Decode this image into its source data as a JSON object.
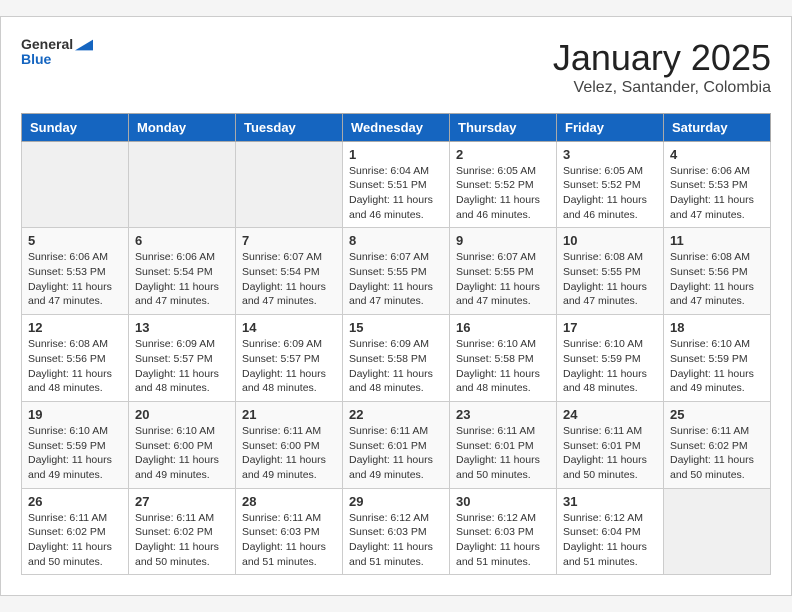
{
  "header": {
    "logo_general": "General",
    "logo_blue": "Blue",
    "month": "January 2025",
    "location": "Velez, Santander, Colombia"
  },
  "weekdays": [
    "Sunday",
    "Monday",
    "Tuesday",
    "Wednesday",
    "Thursday",
    "Friday",
    "Saturday"
  ],
  "weeks": [
    [
      {
        "day": "",
        "info": ""
      },
      {
        "day": "",
        "info": ""
      },
      {
        "day": "",
        "info": ""
      },
      {
        "day": "1",
        "info": "Sunrise: 6:04 AM\nSunset: 5:51 PM\nDaylight: 11 hours and 46 minutes."
      },
      {
        "day": "2",
        "info": "Sunrise: 6:05 AM\nSunset: 5:52 PM\nDaylight: 11 hours and 46 minutes."
      },
      {
        "day": "3",
        "info": "Sunrise: 6:05 AM\nSunset: 5:52 PM\nDaylight: 11 hours and 46 minutes."
      },
      {
        "day": "4",
        "info": "Sunrise: 6:06 AM\nSunset: 5:53 PM\nDaylight: 11 hours and 47 minutes."
      }
    ],
    [
      {
        "day": "5",
        "info": "Sunrise: 6:06 AM\nSunset: 5:53 PM\nDaylight: 11 hours and 47 minutes."
      },
      {
        "day": "6",
        "info": "Sunrise: 6:06 AM\nSunset: 5:54 PM\nDaylight: 11 hours and 47 minutes."
      },
      {
        "day": "7",
        "info": "Sunrise: 6:07 AM\nSunset: 5:54 PM\nDaylight: 11 hours and 47 minutes."
      },
      {
        "day": "8",
        "info": "Sunrise: 6:07 AM\nSunset: 5:55 PM\nDaylight: 11 hours and 47 minutes."
      },
      {
        "day": "9",
        "info": "Sunrise: 6:07 AM\nSunset: 5:55 PM\nDaylight: 11 hours and 47 minutes."
      },
      {
        "day": "10",
        "info": "Sunrise: 6:08 AM\nSunset: 5:55 PM\nDaylight: 11 hours and 47 minutes."
      },
      {
        "day": "11",
        "info": "Sunrise: 6:08 AM\nSunset: 5:56 PM\nDaylight: 11 hours and 47 minutes."
      }
    ],
    [
      {
        "day": "12",
        "info": "Sunrise: 6:08 AM\nSunset: 5:56 PM\nDaylight: 11 hours and 48 minutes."
      },
      {
        "day": "13",
        "info": "Sunrise: 6:09 AM\nSunset: 5:57 PM\nDaylight: 11 hours and 48 minutes."
      },
      {
        "day": "14",
        "info": "Sunrise: 6:09 AM\nSunset: 5:57 PM\nDaylight: 11 hours and 48 minutes."
      },
      {
        "day": "15",
        "info": "Sunrise: 6:09 AM\nSunset: 5:58 PM\nDaylight: 11 hours and 48 minutes."
      },
      {
        "day": "16",
        "info": "Sunrise: 6:10 AM\nSunset: 5:58 PM\nDaylight: 11 hours and 48 minutes."
      },
      {
        "day": "17",
        "info": "Sunrise: 6:10 AM\nSunset: 5:59 PM\nDaylight: 11 hours and 48 minutes."
      },
      {
        "day": "18",
        "info": "Sunrise: 6:10 AM\nSunset: 5:59 PM\nDaylight: 11 hours and 49 minutes."
      }
    ],
    [
      {
        "day": "19",
        "info": "Sunrise: 6:10 AM\nSunset: 5:59 PM\nDaylight: 11 hours and 49 minutes."
      },
      {
        "day": "20",
        "info": "Sunrise: 6:10 AM\nSunset: 6:00 PM\nDaylight: 11 hours and 49 minutes."
      },
      {
        "day": "21",
        "info": "Sunrise: 6:11 AM\nSunset: 6:00 PM\nDaylight: 11 hours and 49 minutes."
      },
      {
        "day": "22",
        "info": "Sunrise: 6:11 AM\nSunset: 6:01 PM\nDaylight: 11 hours and 49 minutes."
      },
      {
        "day": "23",
        "info": "Sunrise: 6:11 AM\nSunset: 6:01 PM\nDaylight: 11 hours and 50 minutes."
      },
      {
        "day": "24",
        "info": "Sunrise: 6:11 AM\nSunset: 6:01 PM\nDaylight: 11 hours and 50 minutes."
      },
      {
        "day": "25",
        "info": "Sunrise: 6:11 AM\nSunset: 6:02 PM\nDaylight: 11 hours and 50 minutes."
      }
    ],
    [
      {
        "day": "26",
        "info": "Sunrise: 6:11 AM\nSunset: 6:02 PM\nDaylight: 11 hours and 50 minutes."
      },
      {
        "day": "27",
        "info": "Sunrise: 6:11 AM\nSunset: 6:02 PM\nDaylight: 11 hours and 50 minutes."
      },
      {
        "day": "28",
        "info": "Sunrise: 6:11 AM\nSunset: 6:03 PM\nDaylight: 11 hours and 51 minutes."
      },
      {
        "day": "29",
        "info": "Sunrise: 6:12 AM\nSunset: 6:03 PM\nDaylight: 11 hours and 51 minutes."
      },
      {
        "day": "30",
        "info": "Sunrise: 6:12 AM\nSunset: 6:03 PM\nDaylight: 11 hours and 51 minutes."
      },
      {
        "day": "31",
        "info": "Sunrise: 6:12 AM\nSunset: 6:04 PM\nDaylight: 11 hours and 51 minutes."
      },
      {
        "day": "",
        "info": ""
      }
    ]
  ]
}
